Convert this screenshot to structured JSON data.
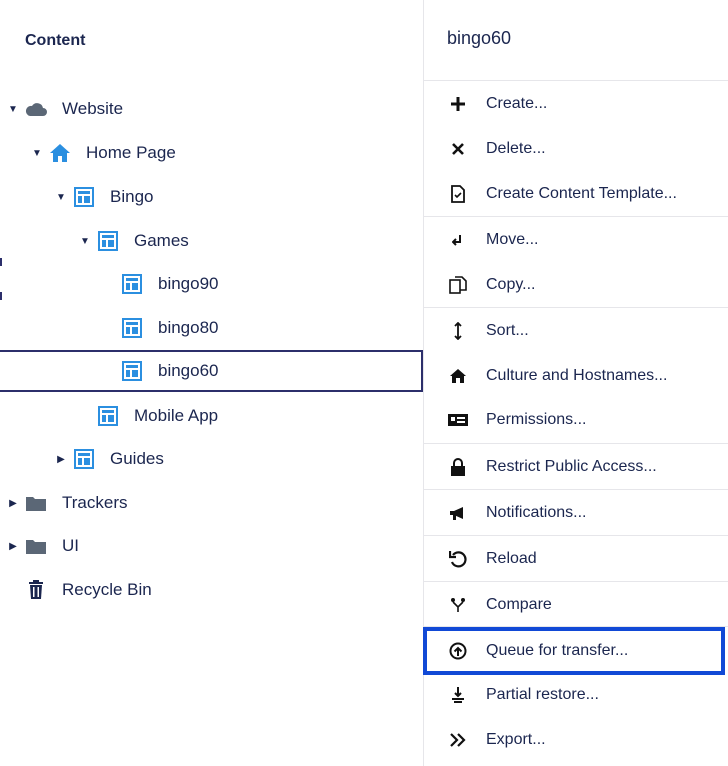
{
  "tree": {
    "title": "Content",
    "items": [
      {
        "label": "Website"
      },
      {
        "label": "Home Page"
      },
      {
        "label": "Bingo"
      },
      {
        "label": "Games"
      },
      {
        "label": "bingo90"
      },
      {
        "label": "bingo80"
      },
      {
        "label": "bingo60"
      },
      {
        "label": "Mobile App"
      },
      {
        "label": "Guides"
      },
      {
        "label": "Trackers"
      },
      {
        "label": "UI"
      },
      {
        "label": "Recycle Bin"
      }
    ]
  },
  "menu": {
    "header": "bingo60",
    "items": [
      {
        "label": "Create..."
      },
      {
        "label": "Delete..."
      },
      {
        "label": "Create Content Template..."
      },
      {
        "label": "Move..."
      },
      {
        "label": "Copy..."
      },
      {
        "label": "Sort..."
      },
      {
        "label": "Culture and Hostnames..."
      },
      {
        "label": "Permissions..."
      },
      {
        "label": "Restrict Public Access..."
      },
      {
        "label": "Notifications..."
      },
      {
        "label": "Reload"
      },
      {
        "label": "Compare"
      },
      {
        "label": "Queue for transfer..."
      },
      {
        "label": "Partial restore..."
      },
      {
        "label": "Export..."
      }
    ]
  },
  "colors": {
    "text": "#1b264f",
    "doc_icon": "#2b8fe0",
    "folder_icon": "#5b6776",
    "highlight_border": "#1149d6"
  }
}
